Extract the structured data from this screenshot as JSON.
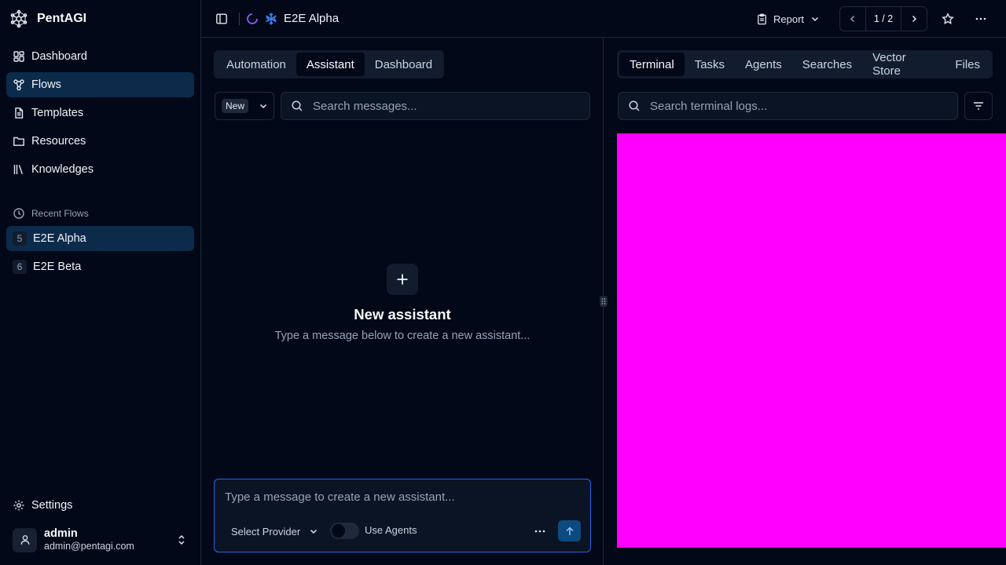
{
  "sidebar": {
    "brand": "PentAGI",
    "nav": [
      {
        "label": "Dashboard",
        "icon": "dashboard-icon"
      },
      {
        "label": "Flows",
        "icon": "workflow-icon"
      },
      {
        "label": "Templates",
        "icon": "file-text-icon"
      },
      {
        "label": "Resources",
        "icon": "folder-icon"
      },
      {
        "label": "Knowledges",
        "icon": "library-icon"
      }
    ],
    "recent_label": "Recent Flows",
    "recent": [
      {
        "num": "5",
        "label": "E2E Alpha"
      },
      {
        "num": "6",
        "label": "E2E Beta"
      }
    ],
    "settings_label": "Settings",
    "user": {
      "name": "admin",
      "email": "admin@pentagi.com"
    }
  },
  "header": {
    "flow_title": "E2E Alpha",
    "report_label": "Report",
    "pager": "1 / 2"
  },
  "assistant": {
    "tabs": [
      "Automation",
      "Assistant",
      "Dashboard"
    ],
    "active_tab": "Assistant",
    "new_label": "New",
    "search_placeholder": "Search messages...",
    "empty_title": "New assistant",
    "empty_sub": "Type a message below to create a new assistant...",
    "composer_placeholder": "Type a message to create a new assistant...",
    "provider_label": "Select Provider",
    "use_agents_label": "Use Agents"
  },
  "panel": {
    "tabs": [
      "Terminal",
      "Tasks",
      "Agents",
      "Searches",
      "Vector Store",
      "Files"
    ],
    "active_tab": "Terminal",
    "search_placeholder": "Search terminal logs..."
  },
  "colors": {
    "background": "#020817",
    "active_nav": "#0c2a4a",
    "accent": "#2563eb",
    "terminal_fill": "#ff00ff"
  }
}
